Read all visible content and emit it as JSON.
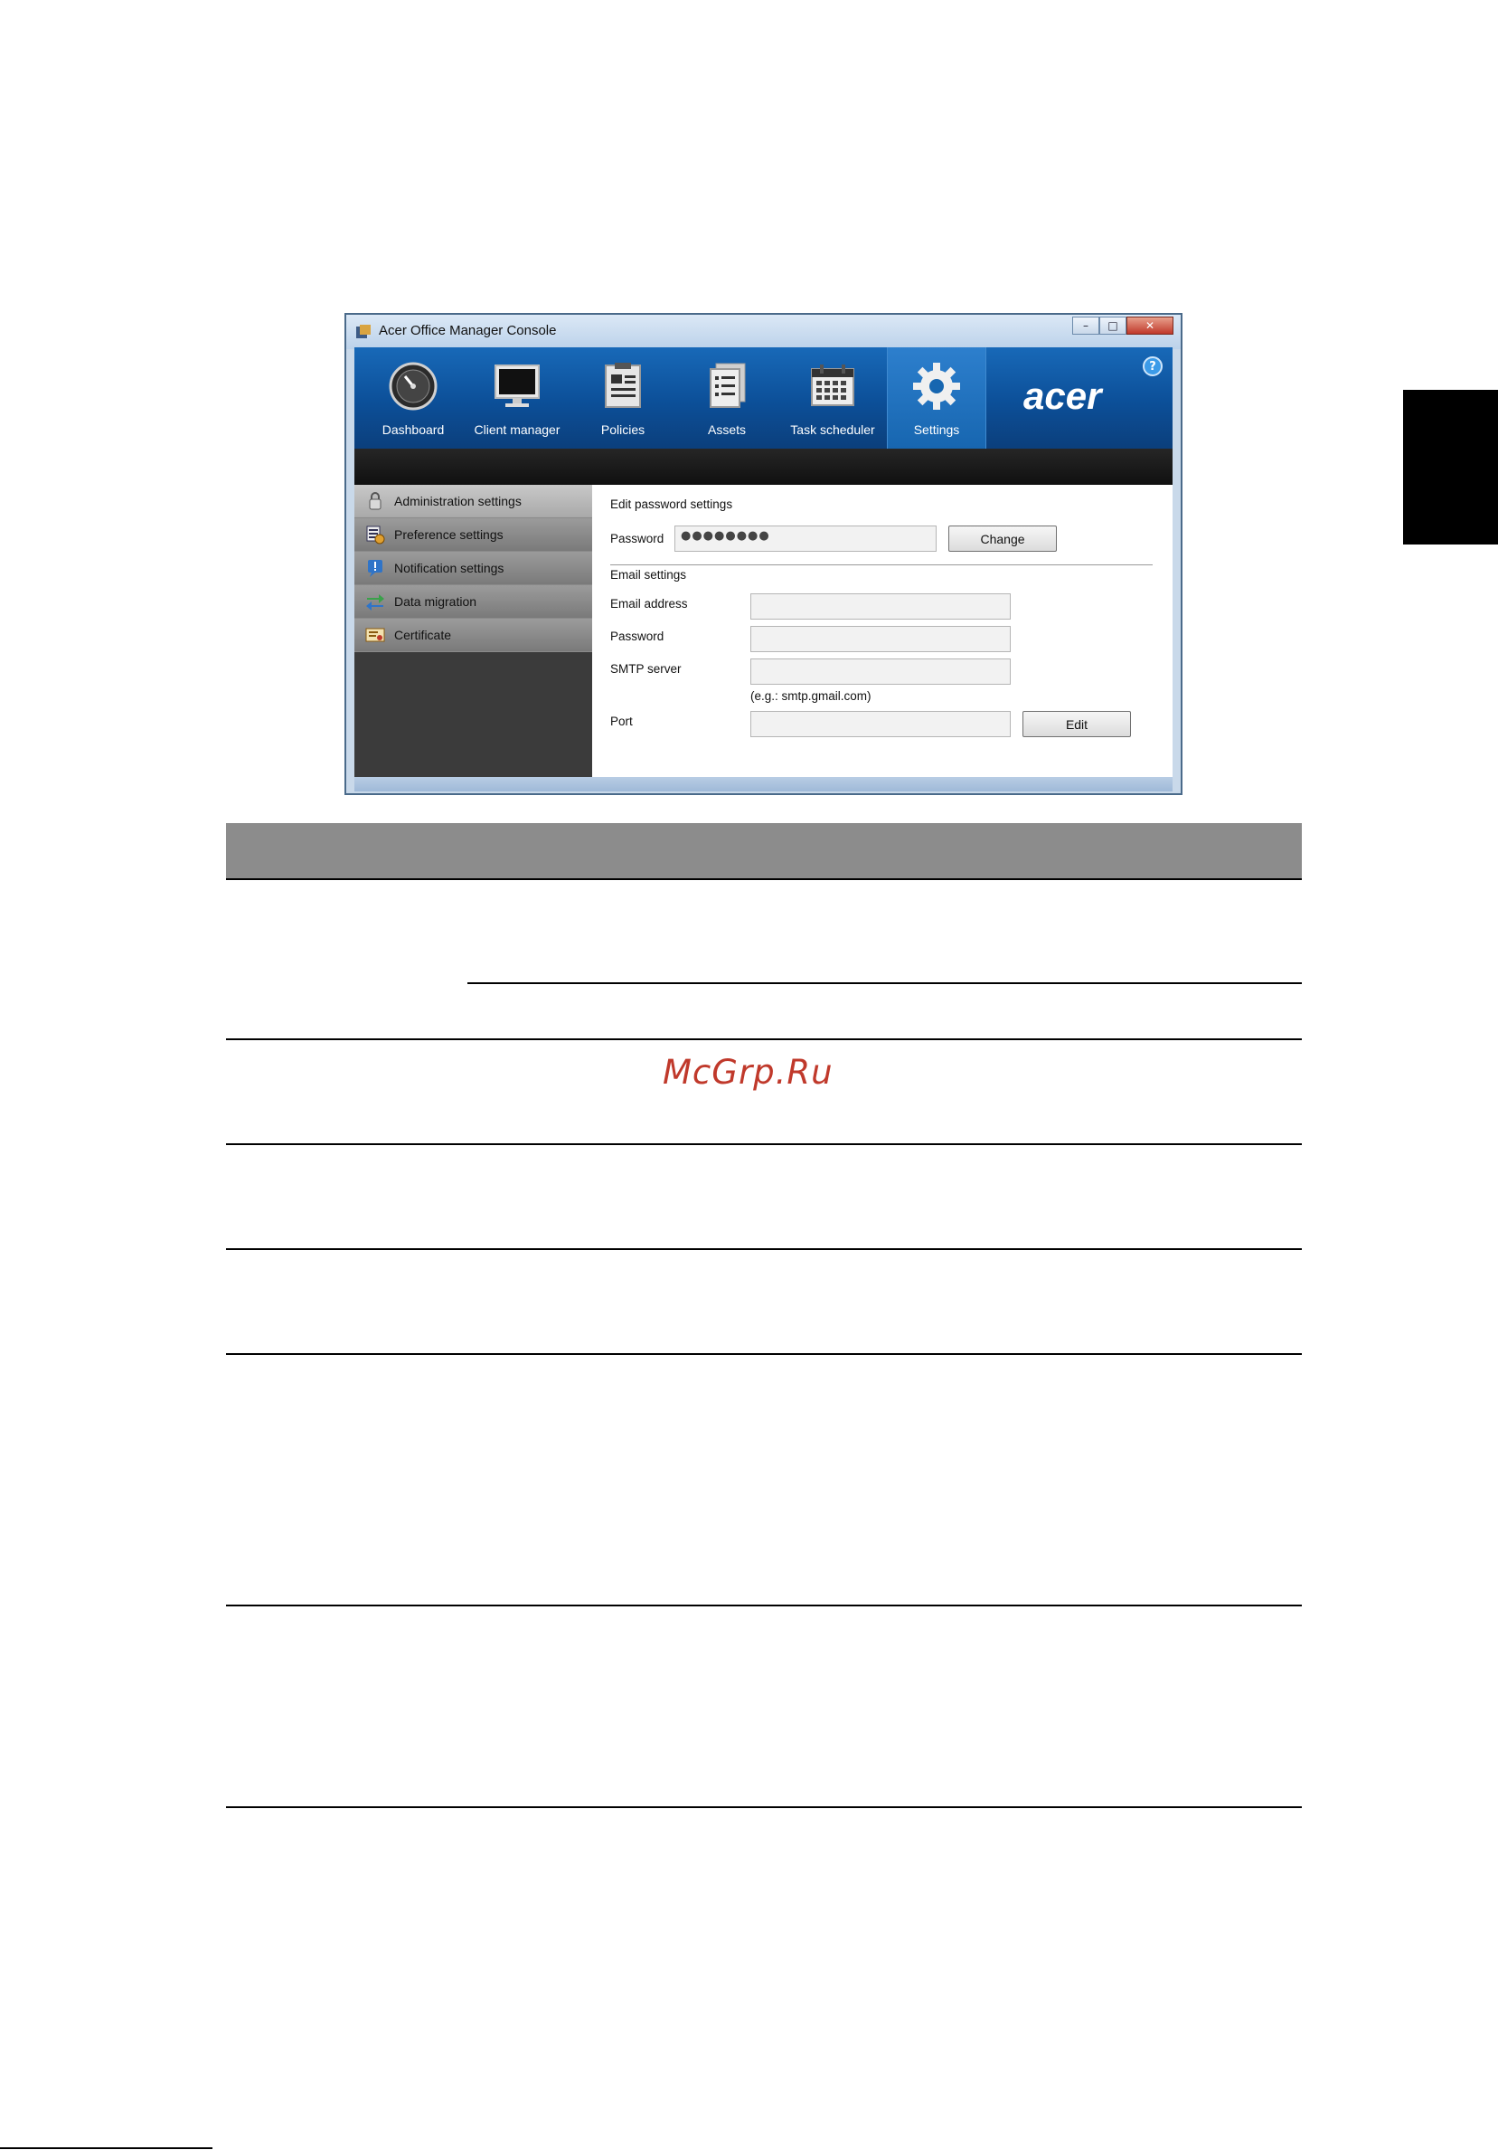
{
  "window": {
    "title": "Acer Office Manager Console",
    "controls": {
      "minimize": "–",
      "maximize": "□",
      "close": "✕"
    }
  },
  "toolbar": {
    "items": [
      {
        "label": "Dashboard",
        "icon": "dashboard-gauge-icon"
      },
      {
        "label": "Client manager",
        "icon": "monitor-icon"
      },
      {
        "label": "Policies",
        "icon": "clipboard-icon"
      },
      {
        "label": "Assets",
        "icon": "document-list-icon"
      },
      {
        "label": "Task scheduler",
        "icon": "calendar-icon"
      },
      {
        "label": "Settings",
        "icon": "gear-icon",
        "active": true
      }
    ],
    "brand": "acer",
    "help": "?"
  },
  "sidebar": {
    "items": [
      {
        "label": "Administration settings",
        "icon": "lock-icon",
        "active": true
      },
      {
        "label": "Preference settings",
        "icon": "preferences-icon"
      },
      {
        "label": "Notification settings",
        "icon": "alert-icon"
      },
      {
        "label": "Data migration",
        "icon": "migration-arrows-icon"
      },
      {
        "label": "Certificate",
        "icon": "certificate-icon"
      }
    ]
  },
  "password_section": {
    "heading": "Edit password settings",
    "password_label": "Password",
    "password_value": "●●●●●●●●",
    "change_button": "Change"
  },
  "email_section": {
    "heading": "Email settings",
    "email_label": "Email address",
    "password_label": "Password",
    "smtp_label": "SMTP server",
    "smtp_hint": "(e.g.: smtp.gmail.com)",
    "port_label": "Port",
    "edit_button": "Edit"
  },
  "watermark": "McGrp.Ru"
}
